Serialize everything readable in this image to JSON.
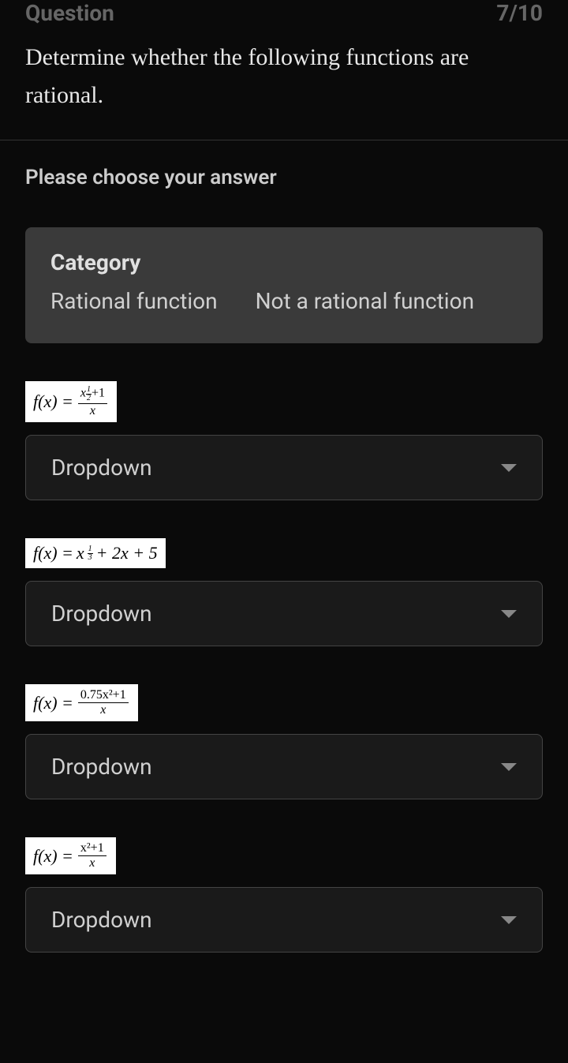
{
  "header": {
    "question_label": "Question",
    "question_count": "7/10",
    "question_text": "Determine whether the following functions are rational."
  },
  "instruction": "Please choose your answer",
  "category": {
    "title": "Category",
    "option1": "Rational function",
    "option2": "Not a rational function"
  },
  "items": [
    {
      "formula_type": "frac_power",
      "prefix": "f(x) = ",
      "numerator_base": "x",
      "numerator_exp_num": "1",
      "numerator_exp_den": "2",
      "numerator_suffix": "+1",
      "denominator": "x",
      "dropdown": "Dropdown"
    },
    {
      "formula_type": "poly_power",
      "prefix": "f(x) = ",
      "base": "x",
      "exp_num": "1",
      "exp_den": "3",
      "suffix": " + 2x + 5",
      "dropdown": "Dropdown"
    },
    {
      "formula_type": "frac_simple",
      "prefix": "f(x) = ",
      "numerator": "0.75x²+1",
      "denominator": "x",
      "dropdown": "Dropdown"
    },
    {
      "formula_type": "frac_simple",
      "prefix": "f(x) = ",
      "numerator": "x²+1",
      "denominator": "x",
      "dropdown": "Dropdown"
    }
  ]
}
